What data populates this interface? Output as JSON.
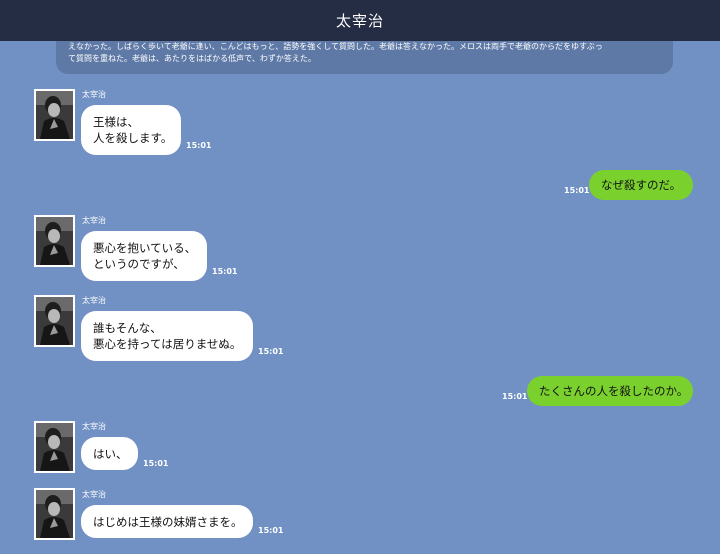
{
  "header": {
    "title": "太宰治"
  },
  "narration": {
    "line1": "えなかった。しばらく歩いて老爺に逢い、こんどはもっと、語勢を強くして質問した。老爺は答えなかった。メロスは両手で老爺のからだをゆすぶっ",
    "line2": "て質問を重ねた。老爺は、あたりをはばかる低声で、わずか答えた。"
  },
  "messages": [
    {
      "side": "in",
      "sender": "太宰治",
      "line1": "王様は、",
      "line2": "人を殺します。",
      "time": "15:01"
    },
    {
      "side": "out",
      "text": "なぜ殺すのだ。",
      "time": "15:01"
    },
    {
      "side": "in",
      "sender": "太宰治",
      "line1": "悪心を抱いている、",
      "line2": "というのですが、",
      "time": "15:01"
    },
    {
      "side": "in",
      "sender": "太宰治",
      "line1": "誰もそんな、",
      "line2": "悪心を持っては居りませぬ。",
      "time": "15:01"
    },
    {
      "side": "out",
      "text": "たくさんの人を殺したのか。",
      "time": "15:01"
    },
    {
      "side": "in",
      "sender": "太宰治",
      "line1": "はい、",
      "time": "15:01"
    },
    {
      "side": "in",
      "sender": "太宰治",
      "line1": "はじめは王様の妹婿さまを。",
      "time": "15:01"
    }
  ],
  "colors": {
    "background": "#7191c4",
    "header": "#252d44",
    "incoming_bubble": "#ffffff",
    "outgoing_bubble": "#7ad12e"
  },
  "icons": {
    "avatar": "author-portrait"
  }
}
